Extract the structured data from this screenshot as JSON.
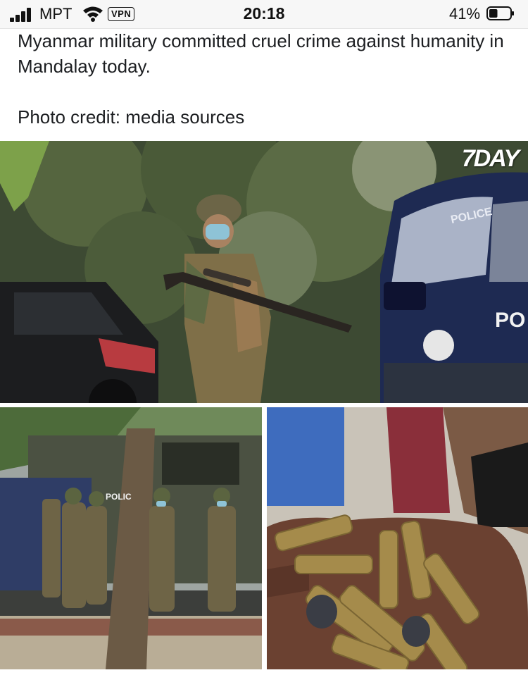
{
  "status_bar": {
    "carrier": "MPT",
    "vpn": "VPN",
    "time": "20:18",
    "battery": "41%",
    "battery_level": 0.41
  },
  "post": {
    "text": "Myanmar military committed cruel crime against humanity in Mandalay today.",
    "credit": "Photo credit: media sources"
  },
  "photos": {
    "top": {
      "watermark": "7DAY",
      "vehicle_label": "PO",
      "windshield_label": "POLICE"
    },
    "bottom_left": {
      "vehicle_label": "POLIC"
    }
  }
}
